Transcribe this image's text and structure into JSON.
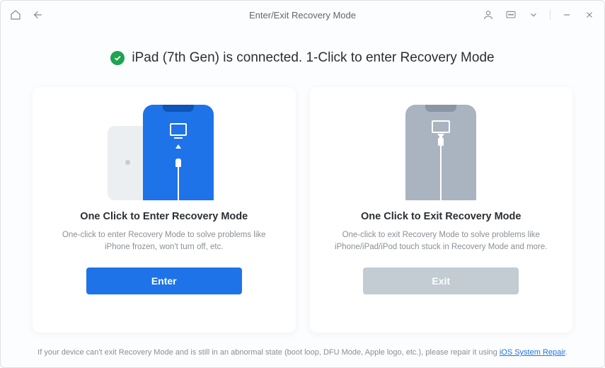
{
  "titlebar": {
    "title": "Enter/Exit Recovery Mode"
  },
  "status": {
    "text": "iPad (7th Gen) is connected. 1-Click to enter Recovery Mode"
  },
  "cards": {
    "enter": {
      "title": "One Click to Enter Recovery Mode",
      "desc": "One-click to enter Recovery Mode to solve problems like iPhone frozen, won't turn off, etc.",
      "button": "Enter"
    },
    "exit": {
      "title": "One Click to Exit Recovery Mode",
      "desc": "One-click to exit Recovery Mode to solve problems like iPhone/iPad/iPod touch stuck in Recovery Mode and more.",
      "button": "Exit"
    }
  },
  "footer": {
    "prefix": "If your device can't exit Recovery Mode and is still in an abnormal state (boot loop, DFU Mode, Apple logo, etc.), please repair it using ",
    "link": "iOS System Repair",
    "suffix": "."
  }
}
